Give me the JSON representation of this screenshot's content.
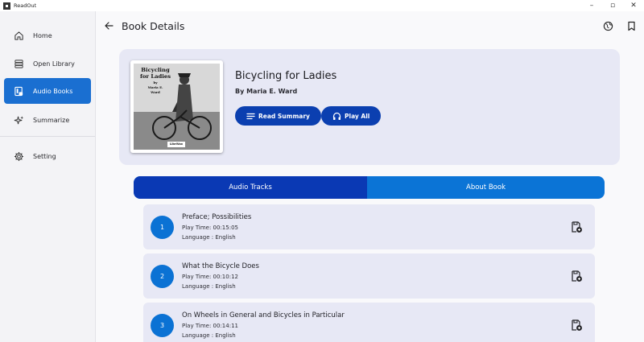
{
  "window": {
    "title": "ReadOut",
    "controls": [
      "–",
      "▫",
      "✕"
    ]
  },
  "sidebar": {
    "items": [
      {
        "label": "Home",
        "icon": "home-icon"
      },
      {
        "label": "Open Library",
        "icon": "library-icon"
      },
      {
        "label": "Audio Books",
        "icon": "audiobook-icon",
        "active": true
      },
      {
        "label": "Summarize",
        "icon": "sparkle-icon"
      },
      {
        "label": "Setting",
        "icon": "gear-icon"
      }
    ]
  },
  "header": {
    "title": "Book Details",
    "icons": [
      "back-arrow-icon",
      "globe-icon",
      "bookmark-icon"
    ]
  },
  "book": {
    "title": "Bicycling for Ladies",
    "author": "By Maria E. Ward",
    "cover": {
      "line1": "Bicycling",
      "line2": "for Ladies",
      "line3": "by",
      "line4": "Maria E.",
      "line5": "Ward",
      "badge": "LibriVox"
    },
    "actions": {
      "read_summary": "Read Summary",
      "play_all": "Play All"
    }
  },
  "tabs": [
    {
      "label": "Audio Tracks",
      "active": true
    },
    {
      "label": "About Book",
      "active": false
    }
  ],
  "tracks": [
    {
      "number": "1",
      "title": "Preface; Possibilities",
      "play_time": "Play Time: 00:15:05",
      "language": "Language : English"
    },
    {
      "number": "2",
      "title": "What the Bicycle Does",
      "play_time": "Play Time: 00:10:12",
      "language": "Language : English"
    },
    {
      "number": "3",
      "title": "On Wheels in General and Bicycles in Particular",
      "play_time": "Play Time: 00:14:11",
      "language": "Language : English"
    }
  ],
  "colors": {
    "accent": "#1a6fd1",
    "primary_dark": "#0b3fb0",
    "tab_bar": "#0b74d6",
    "card_bg": "#e7e8f5"
  }
}
